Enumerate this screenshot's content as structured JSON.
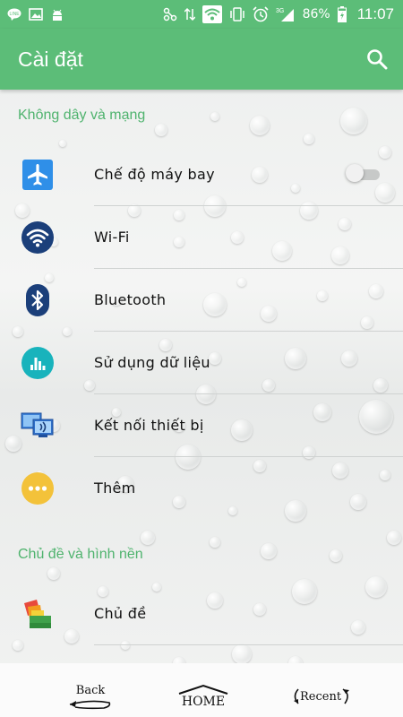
{
  "status_bar": {
    "time": "11:07",
    "battery": "86%",
    "network": "3G",
    "icons": [
      "line-icon",
      "image-icon",
      "android-icon",
      "sync-icon",
      "data-arrows-icon",
      "wifi-icon",
      "vibrate-icon",
      "alarm-icon",
      "signal-icon",
      "battery-icon"
    ]
  },
  "app_bar": {
    "title": "Cài đặt",
    "search_icon": "search-icon"
  },
  "sections": [
    {
      "header": "Không dây và mạng",
      "items": [
        {
          "label": "Chế độ máy bay",
          "icon": "airplane-icon",
          "toggle": "off"
        },
        {
          "label": "Wi-Fi",
          "icon": "wifi-icon"
        },
        {
          "label": "Bluetooth",
          "icon": "bluetooth-icon"
        },
        {
          "label": "Sử dụng dữ liệu",
          "icon": "data-usage-icon"
        },
        {
          "label": "Kết nối thiết bị",
          "icon": "device-connection-icon"
        },
        {
          "label": "Thêm",
          "icon": "more-icon"
        }
      ]
    },
    {
      "header": "Chủ đề và hình nền",
      "items": [
        {
          "label": "Chủ đề",
          "icon": "themes-icon"
        }
      ]
    }
  ],
  "bottom_nav": {
    "back": "Back",
    "home": "HOME",
    "recent": "Recent"
  },
  "colors": {
    "accent": "#5cbd78",
    "section_header": "#4fb36e"
  }
}
